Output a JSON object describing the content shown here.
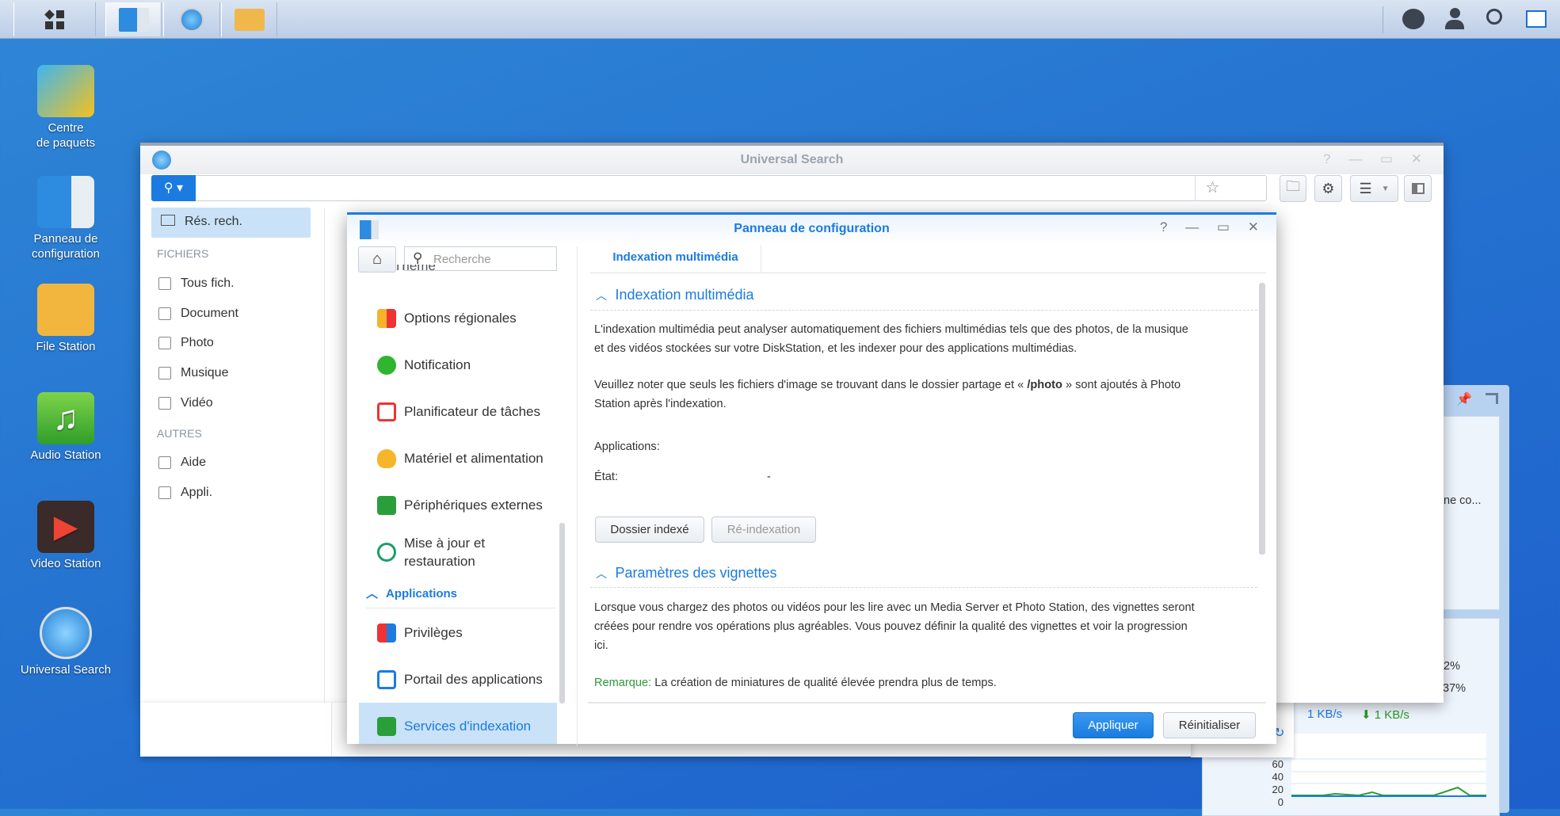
{
  "taskbar": {
    "start_icon": "grid-icon",
    "apps": [
      "control-panel-icon",
      "universal-search-icon",
      "file-station-icon"
    ],
    "right_icons": [
      "chat-icon",
      "user-icon",
      "search-icon",
      "widgets-icon"
    ]
  },
  "desktop": {
    "icons": [
      {
        "label1": "Centre",
        "label2": "de paquets"
      },
      {
        "label1": "Panneau de",
        "label2": "configuration"
      },
      {
        "label1": "File Station",
        "label2": ""
      },
      {
        "label1": "Audio Station",
        "label2": ""
      },
      {
        "label1": "Video Station",
        "label2": ""
      },
      {
        "label1": "Universal Search",
        "label2": ""
      }
    ]
  },
  "search_window": {
    "title": "Universal Search",
    "controls": [
      "?",
      "—",
      "▭",
      "✕"
    ],
    "search_value": "",
    "sidebar": {
      "selected": "Rés. rech.",
      "files_header": "FICHIERS",
      "files": [
        "Tous fich.",
        "Document",
        "Photo",
        "Musique",
        "Vidéo"
      ],
      "others_header": "AUTRES",
      "others": [
        "Aide",
        "Appli."
      ]
    }
  },
  "widget": {
    "text1": "ne co...",
    "pct1": "2%",
    "pct2": "37%",
    "upload": "1 KB/s",
    "download": "1 KB/s",
    "chart_ticks": [
      "60",
      "40",
      "20",
      "0"
    ]
  },
  "control_panel": {
    "title": "Panneau de configuration",
    "search_placeholder": "Recherche",
    "nav": {
      "partial": "Thème",
      "items": [
        "Options régionales",
        "Notification",
        "Planificateur de tâches",
        "Matériel et alimentation",
        "Périphériques externes"
      ],
      "update_line1": "Mise à jour et",
      "update_line2": "restauration",
      "apps_header": "Applications",
      "apps": [
        "Privilèges",
        "Portail des applications",
        "Services d'indexation"
      ]
    },
    "tab": "Indexation multimédia",
    "section1": {
      "title": "Indexation multimédia",
      "p1": [
        "L'indexation multimédia peut analyser automatiquement des fichiers multimédias tels que des photos, de la musique",
        "et des vidéos stockées sur votre DiskStation, et les indexer pour des applications multimédias."
      ],
      "p2a": "Veuillez noter que seuls les fichiers d'image se trouvant dans le dossier partage et « ",
      "p2b": "/photo",
      "p2c": " » sont ajoutés à Photo",
      "p2d": "Station après l'indexation.",
      "apps_label": "Applications:",
      "state_label": "État:",
      "state_value": "-",
      "btn_folder": "Dossier indexé",
      "btn_reindex": "Ré-indexation"
    },
    "section2": {
      "title": "Paramètres des vignettes",
      "p": [
        "Lorsque vous chargez des photos ou vidéos pour les lire avec un Media Server et Photo Station, des vignettes seront",
        "créées pour rendre vos opérations plus agréables. Vous pouvez définir la qualité des vignettes et voir la progression",
        "ici."
      ],
      "note_label": "Remarque:",
      "note": " La création de miniatures de qualité élevée prendra plus de temps."
    },
    "apply": "Appliquer",
    "reset": "Réinitialiser"
  },
  "colors": {
    "accent": "#1b7be0",
    "note": "#2a9a3a"
  }
}
